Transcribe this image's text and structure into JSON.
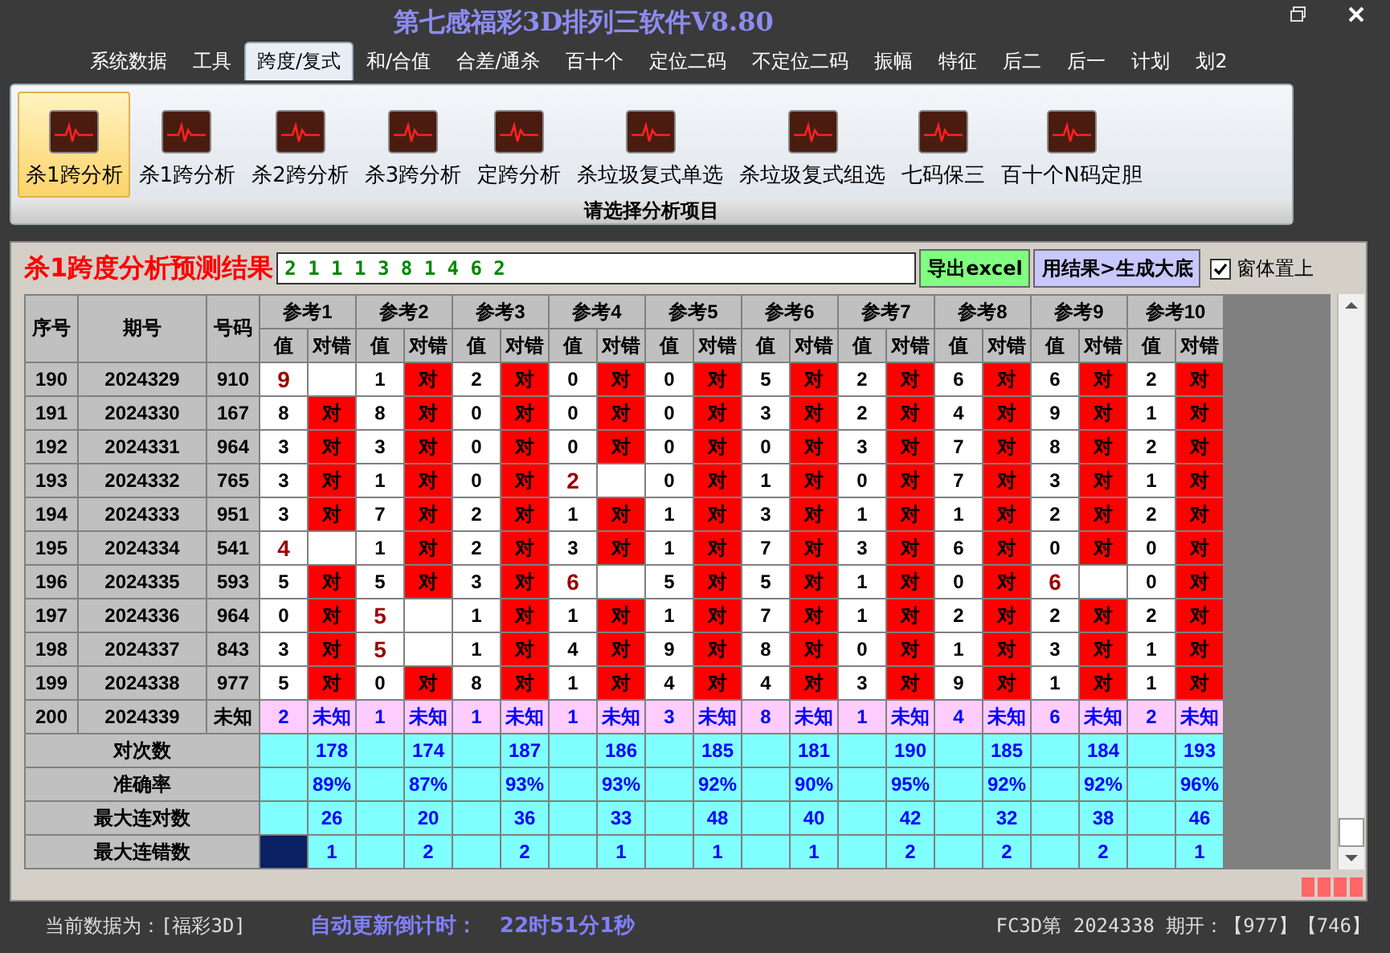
{
  "window": {
    "title": "第七感福彩3D排列三软件V8.80"
  },
  "menu": [
    {
      "label": "系统数据",
      "selected": false
    },
    {
      "label": "工具",
      "selected": false
    },
    {
      "label": "跨度/复式",
      "selected": true
    },
    {
      "label": "和/合值",
      "selected": false
    },
    {
      "label": "合差/通杀",
      "selected": false
    },
    {
      "label": "百十个",
      "selected": false
    },
    {
      "label": "定位二码",
      "selected": false
    },
    {
      "label": "不定位二码",
      "selected": false
    },
    {
      "label": "振幅",
      "selected": false
    },
    {
      "label": "特征",
      "selected": false
    },
    {
      "label": "后二",
      "selected": false
    },
    {
      "label": "后一",
      "selected": false
    },
    {
      "label": "计划",
      "selected": false
    },
    {
      "label": "划2",
      "selected": false
    }
  ],
  "ribbon": {
    "items": [
      {
        "label": "杀1跨分析",
        "selected": true
      },
      {
        "label": "杀1跨分析",
        "selected": false
      },
      {
        "label": "杀2跨分析",
        "selected": false
      },
      {
        "label": "杀3跨分析",
        "selected": false
      },
      {
        "label": "定跨分析",
        "selected": false
      },
      {
        "label": "杀垃圾复式单选",
        "selected": false
      },
      {
        "label": "杀垃圾复式组选",
        "selected": false
      },
      {
        "label": "七码保三",
        "selected": false
      },
      {
        "label": "百十个N码定胆",
        "selected": false
      }
    ],
    "group_label": "请选择分析项目"
  },
  "result": {
    "label": "杀1跨度分析预测结果",
    "value": "2 1 1 1 3 8 1 4 6 2",
    "buttons": [
      {
        "label": "导出excel",
        "kind": "export"
      },
      {
        "label": "用结果>生成大底",
        "kind": "generate"
      }
    ],
    "pin": {
      "label": "窗体置上",
      "checked": true
    }
  },
  "table": {
    "columns": [
      "序号",
      "期号",
      "号码"
    ],
    "groups": [
      {
        "label": "参考1",
        "sub": [
          "值",
          "对错"
        ]
      },
      {
        "label": "参考2",
        "sub": [
          "值",
          "对错"
        ]
      },
      {
        "label": "参考3",
        "sub": [
          "值",
          "对错"
        ]
      },
      {
        "label": "参考4",
        "sub": [
          "值",
          "对错"
        ]
      },
      {
        "label": "参考5",
        "sub": [
          "值",
          "对错"
        ]
      },
      {
        "label": "参考6",
        "sub": [
          "值",
          "对错"
        ]
      },
      {
        "label": "参考7",
        "sub": [
          "值",
          "对错"
        ]
      },
      {
        "label": "参考8",
        "sub": [
          "值",
          "对错"
        ]
      },
      {
        "label": "参考9",
        "sub": [
          "值",
          "对错"
        ]
      },
      {
        "label": "参考10",
        "sub": [
          "值",
          "对错"
        ]
      }
    ],
    "rows": [
      {
        "seq": "190",
        "period": "2024329",
        "number": "910",
        "cells": [
          {
            "value": "9",
            "hit": false
          },
          {
            "value": "1",
            "hit": true,
            "mark": "对"
          },
          {
            "value": "2",
            "hit": true,
            "mark": "对"
          },
          {
            "value": "0",
            "hit": true,
            "mark": "对"
          },
          {
            "value": "0",
            "hit": true,
            "mark": "对"
          },
          {
            "value": "5",
            "hit": true,
            "mark": "对"
          },
          {
            "value": "2",
            "hit": true,
            "mark": "对"
          },
          {
            "value": "6",
            "hit": true,
            "mark": "对"
          },
          {
            "value": "6",
            "hit": true,
            "mark": "对"
          },
          {
            "value": "2",
            "hit": true,
            "mark": "对"
          }
        ]
      },
      {
        "seq": "191",
        "period": "2024330",
        "number": "167",
        "cells": [
          {
            "value": "8",
            "hit": true,
            "mark": "对"
          },
          {
            "value": "8",
            "hit": true,
            "mark": "对"
          },
          {
            "value": "0",
            "hit": true,
            "mark": "对"
          },
          {
            "value": "0",
            "hit": true,
            "mark": "对"
          },
          {
            "value": "0",
            "hit": true,
            "mark": "对"
          },
          {
            "value": "3",
            "hit": true,
            "mark": "对"
          },
          {
            "value": "2",
            "hit": true,
            "mark": "对"
          },
          {
            "value": "4",
            "hit": true,
            "mark": "对"
          },
          {
            "value": "9",
            "hit": true,
            "mark": "对"
          },
          {
            "value": "1",
            "hit": true,
            "mark": "对"
          }
        ]
      },
      {
        "seq": "192",
        "period": "2024331",
        "number": "964",
        "cells": [
          {
            "value": "3",
            "hit": true,
            "mark": "对"
          },
          {
            "value": "3",
            "hit": true,
            "mark": "对"
          },
          {
            "value": "0",
            "hit": true,
            "mark": "对"
          },
          {
            "value": "0",
            "hit": true,
            "mark": "对"
          },
          {
            "value": "0",
            "hit": true,
            "mark": "对"
          },
          {
            "value": "0",
            "hit": true,
            "mark": "对"
          },
          {
            "value": "3",
            "hit": true,
            "mark": "对"
          },
          {
            "value": "7",
            "hit": true,
            "mark": "对"
          },
          {
            "value": "8",
            "hit": true,
            "mark": "对"
          },
          {
            "value": "2",
            "hit": true,
            "mark": "对"
          }
        ]
      },
      {
        "seq": "193",
        "period": "2024332",
        "number": "765",
        "cells": [
          {
            "value": "3",
            "hit": true,
            "mark": "对"
          },
          {
            "value": "1",
            "hit": true,
            "mark": "对"
          },
          {
            "value": "0",
            "hit": true,
            "mark": "对"
          },
          {
            "value": "2",
            "hit": false
          },
          {
            "value": "0",
            "hit": true,
            "mark": "对"
          },
          {
            "value": "1",
            "hit": true,
            "mark": "对"
          },
          {
            "value": "0",
            "hit": true,
            "mark": "对"
          },
          {
            "value": "7",
            "hit": true,
            "mark": "对"
          },
          {
            "value": "3",
            "hit": true,
            "mark": "对"
          },
          {
            "value": "1",
            "hit": true,
            "mark": "对"
          }
        ]
      },
      {
        "seq": "194",
        "period": "2024333",
        "number": "951",
        "cells": [
          {
            "value": "3",
            "hit": true,
            "mark": "对"
          },
          {
            "value": "7",
            "hit": true,
            "mark": "对"
          },
          {
            "value": "2",
            "hit": true,
            "mark": "对"
          },
          {
            "value": "1",
            "hit": true,
            "mark": "对"
          },
          {
            "value": "1",
            "hit": true,
            "mark": "对"
          },
          {
            "value": "3",
            "hit": true,
            "mark": "对"
          },
          {
            "value": "1",
            "hit": true,
            "mark": "对"
          },
          {
            "value": "1",
            "hit": true,
            "mark": "对"
          },
          {
            "value": "2",
            "hit": true,
            "mark": "对"
          },
          {
            "value": "2",
            "hit": true,
            "mark": "对"
          }
        ]
      },
      {
        "seq": "195",
        "period": "2024334",
        "number": "541",
        "cells": [
          {
            "value": "4",
            "hit": false
          },
          {
            "value": "1",
            "hit": true,
            "mark": "对"
          },
          {
            "value": "2",
            "hit": true,
            "mark": "对"
          },
          {
            "value": "3",
            "hit": true,
            "mark": "对"
          },
          {
            "value": "1",
            "hit": true,
            "mark": "对"
          },
          {
            "value": "7",
            "hit": true,
            "mark": "对"
          },
          {
            "value": "3",
            "hit": true,
            "mark": "对"
          },
          {
            "value": "6",
            "hit": true,
            "mark": "对"
          },
          {
            "value": "0",
            "hit": true,
            "mark": "对"
          },
          {
            "value": "0",
            "hit": true,
            "mark": "对"
          }
        ]
      },
      {
        "seq": "196",
        "period": "2024335",
        "number": "593",
        "cells": [
          {
            "value": "5",
            "hit": true,
            "mark": "对"
          },
          {
            "value": "5",
            "hit": true,
            "mark": "对"
          },
          {
            "value": "3",
            "hit": true,
            "mark": "对"
          },
          {
            "value": "6",
            "hit": false
          },
          {
            "value": "5",
            "hit": true,
            "mark": "对"
          },
          {
            "value": "5",
            "hit": true,
            "mark": "对"
          },
          {
            "value": "1",
            "hit": true,
            "mark": "对"
          },
          {
            "value": "0",
            "hit": true,
            "mark": "对"
          },
          {
            "value": "6",
            "hit": false
          },
          {
            "value": "0",
            "hit": true,
            "mark": "对"
          }
        ]
      },
      {
        "seq": "197",
        "period": "2024336",
        "number": "964",
        "cells": [
          {
            "value": "0",
            "hit": true,
            "mark": "对"
          },
          {
            "value": "5",
            "hit": false
          },
          {
            "value": "1",
            "hit": true,
            "mark": "对"
          },
          {
            "value": "1",
            "hit": true,
            "mark": "对"
          },
          {
            "value": "1",
            "hit": true,
            "mark": "对"
          },
          {
            "value": "7",
            "hit": true,
            "mark": "对"
          },
          {
            "value": "1",
            "hit": true,
            "mark": "对"
          },
          {
            "value": "2",
            "hit": true,
            "mark": "对"
          },
          {
            "value": "2",
            "hit": true,
            "mark": "对"
          },
          {
            "value": "2",
            "hit": true,
            "mark": "对"
          }
        ]
      },
      {
        "seq": "198",
        "period": "2024337",
        "number": "843",
        "cells": [
          {
            "value": "3",
            "hit": true,
            "mark": "对"
          },
          {
            "value": "5",
            "hit": false
          },
          {
            "value": "1",
            "hit": true,
            "mark": "对"
          },
          {
            "value": "4",
            "hit": true,
            "mark": "对"
          },
          {
            "value": "9",
            "hit": true,
            "mark": "对"
          },
          {
            "value": "8",
            "hit": true,
            "mark": "对"
          },
          {
            "value": "0",
            "hit": true,
            "mark": "对"
          },
          {
            "value": "1",
            "hit": true,
            "mark": "对"
          },
          {
            "value": "3",
            "hit": true,
            "mark": "对"
          },
          {
            "value": "1",
            "hit": true,
            "mark": "对"
          }
        ]
      },
      {
        "seq": "199",
        "period": "2024338",
        "number": "977",
        "cells": [
          {
            "value": "5",
            "hit": true,
            "mark": "对"
          },
          {
            "value": "0",
            "hit": true,
            "mark": "对"
          },
          {
            "value": "8",
            "hit": true,
            "mark": "对"
          },
          {
            "value": "1",
            "hit": true,
            "mark": "对"
          },
          {
            "value": "4",
            "hit": true,
            "mark": "对"
          },
          {
            "value": "4",
            "hit": true,
            "mark": "对"
          },
          {
            "value": "3",
            "hit": true,
            "mark": "对"
          },
          {
            "value": "9",
            "hit": true,
            "mark": "对"
          },
          {
            "value": "1",
            "hit": true,
            "mark": "对"
          },
          {
            "value": "1",
            "hit": true,
            "mark": "对"
          }
        ]
      }
    ],
    "prediction": {
      "seq": "200",
      "period": "2024339",
      "number": "未知",
      "cells": [
        {
          "value": "2",
          "mark": "未知"
        },
        {
          "value": "1",
          "mark": "未知"
        },
        {
          "value": "1",
          "mark": "未知"
        },
        {
          "value": "1",
          "mark": "未知"
        },
        {
          "value": "3",
          "mark": "未知"
        },
        {
          "value": "8",
          "mark": "未知"
        },
        {
          "value": "1",
          "mark": "未知"
        },
        {
          "value": "4",
          "mark": "未知"
        },
        {
          "value": "6",
          "mark": "未知"
        },
        {
          "value": "2",
          "mark": "未知"
        }
      ]
    },
    "stats": [
      {
        "label": "对次数",
        "selected": false,
        "values": [
          "178",
          "174",
          "187",
          "186",
          "185",
          "181",
          "190",
          "185",
          "184",
          "193"
        ]
      },
      {
        "label": "准确率",
        "selected": false,
        "values": [
          "89%",
          "87%",
          "93%",
          "93%",
          "92%",
          "90%",
          "95%",
          "92%",
          "92%",
          "96%"
        ]
      },
      {
        "label": "最大连对数",
        "selected": false,
        "values": [
          "26",
          "20",
          "36",
          "33",
          "48",
          "40",
          "42",
          "32",
          "38",
          "46"
        ]
      },
      {
        "label": "最大连错数",
        "selected": true,
        "values": [
          "1",
          "2",
          "2",
          "1",
          "1",
          "1",
          "2",
          "2",
          "2",
          "1"
        ]
      }
    ]
  },
  "status_bar": {
    "data_source": "当前数据为：[福彩3D]",
    "countdown_label": "自动更新倒计时：",
    "countdown": "22时51分1秒",
    "latest": "FC3D第 2024338 期开：【977】【746】"
  }
}
